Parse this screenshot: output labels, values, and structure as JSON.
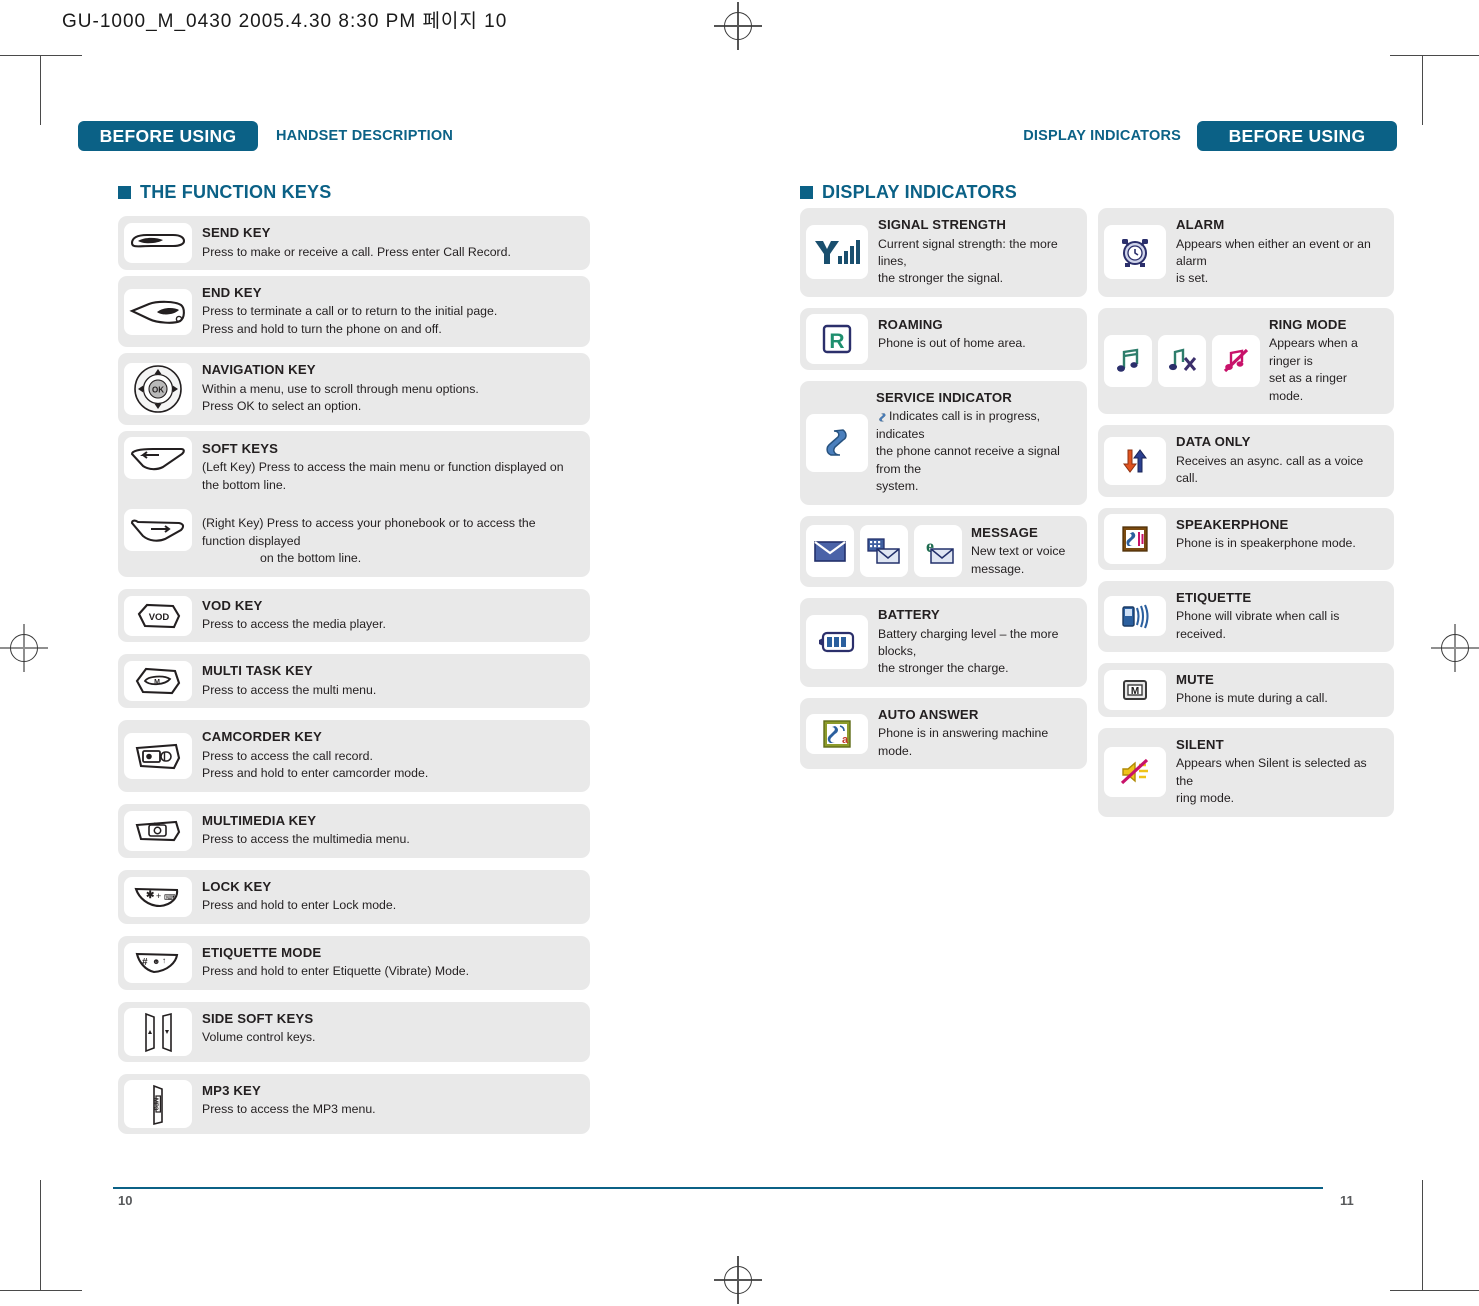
{
  "print_header": "GU-1000_M_0430  2005.4.30 8:30 PM  페이지 10",
  "brand_color": "#0b6186",
  "panel_color": "#e9e9e9",
  "left_page": {
    "running_head": {
      "tag": "BEFORE USING",
      "subject": "HANDSET DESCRIPTION"
    },
    "section_title": "THE FUNCTION KEYS",
    "page_number": "10",
    "items": [
      {
        "icon": "send-key-icon",
        "title": "SEND KEY",
        "lines": [
          "Press to make or receive a call. Press enter Call Record."
        ]
      },
      {
        "icon": "end-key-icon",
        "title": "END KEY",
        "lines": [
          "Press to terminate a call or to return to the initial page.",
          "Press and hold to turn the phone on and off."
        ]
      },
      {
        "icon": "navigation-key-icon",
        "title": "NAVIGATION KEY",
        "lines": [
          "Within a menu, use to scroll through menu options.",
          "Press  OK  to select an option."
        ]
      },
      {
        "icon": "soft-key-left-icon",
        "title": "SOFT KEYS",
        "lines": [
          "(Left Key) Press to access the main menu or function displayed on the bottom line."
        ],
        "second_icon": "soft-key-right-icon",
        "second_lines": [
          "(Right Key) Press to access your phonebook or to access the function displayed",
          "on the bottom line."
        ]
      },
      {
        "icon": "vod-key-icon",
        "title": "VOD KEY",
        "lines": [
          "Press to access the media player."
        ]
      },
      {
        "icon": "multi-task-key-icon",
        "title": "MULTI TASK KEY",
        "lines": [
          "Press to access the multi menu."
        ]
      },
      {
        "icon": "camcorder-key-icon",
        "title": "CAMCORDER KEY",
        "lines": [
          "Press to access the call record.",
          "Press and hold to enter camcorder mode."
        ]
      },
      {
        "icon": "multimedia-key-icon",
        "title": "MULTIMEDIA KEY",
        "lines": [
          "Press to access the multimedia menu."
        ]
      },
      {
        "icon": "lock-key-icon",
        "title": "LOCK KEY",
        "lines": [
          "Press and hold to enter Lock mode."
        ]
      },
      {
        "icon": "etiquette-mode-key-icon",
        "title": "ETIQUETTE MODE",
        "lines": [
          "Press and hold to enter Etiquette (Vibrate) Mode."
        ]
      },
      {
        "icon": "side-soft-keys-icon",
        "title": "SIDE SOFT KEYS",
        "lines": [
          "Volume control keys."
        ]
      },
      {
        "icon": "mp3-key-icon",
        "title": "MP3 KEY",
        "lines": [
          "Press to access the MP3 menu."
        ]
      }
    ]
  },
  "right_page": {
    "running_head": {
      "tag": "BEFORE USING",
      "subject": "DISPLAY INDICATORS"
    },
    "section_title": "DISPLAY INDICATORS",
    "page_number": "11",
    "column_left": [
      {
        "icon": "signal-strength-icon",
        "title": "SIGNAL STRENGTH",
        "lines": [
          "Current signal strength: the more lines,",
          "the stronger the signal."
        ]
      },
      {
        "icon": "roaming-icon",
        "title": "ROAMING",
        "lines": [
          "Phone is out of home area."
        ]
      },
      {
        "icon": "service-indicator-icon",
        "title": "SERVICE INDICATOR",
        "lines": [
          "Indicates call is in progress,  indicates",
          "the phone cannot receive a signal from the",
          "system."
        ]
      },
      {
        "icon": "message-icon",
        "icons": [
          "mail-envelope-icon",
          "text-message-icon",
          "voice-message-icon"
        ],
        "title": "MESSAGE",
        "lines": [
          "New text or voice",
          "message."
        ]
      },
      {
        "icon": "battery-icon",
        "title": "BATTERY",
        "lines": [
          "Battery charging level – the more blocks,",
          "the stronger the charge."
        ]
      },
      {
        "icon": "auto-answer-icon",
        "title": "AUTO ANSWER",
        "lines": [
          "Phone is in answering machine mode."
        ]
      }
    ],
    "column_right": [
      {
        "icon": "alarm-icon",
        "title": "ALARM",
        "lines": [
          "Appears when either an event or an alarm",
          "is set."
        ]
      },
      {
        "icon": "ring-mode-icon",
        "icons": [
          "ringer-on-icon",
          "ringer-off-icon",
          "ringer-silent-icon"
        ],
        "title": "RING MODE",
        "lines": [
          "Appears when a ringer is",
          "set as a ringer mode."
        ]
      },
      {
        "icon": "data-only-icon",
        "title": "DATA ONLY",
        "lines": [
          "Receives an async. call as a voice call."
        ]
      },
      {
        "icon": "speakerphone-icon",
        "title": "SPEAKERPHONE",
        "lines": [
          "Phone is in speakerphone mode."
        ]
      },
      {
        "icon": "etiquette-icon",
        "title": "ETIQUETTE",
        "lines": [
          "Phone will vibrate when call is received."
        ]
      },
      {
        "icon": "mute-icon",
        "title": "MUTE",
        "lines": [
          "Phone is mute during a call."
        ]
      },
      {
        "icon": "silent-icon",
        "title": "SILENT",
        "lines": [
          "Appears when Silent is selected as the",
          "ring mode."
        ]
      }
    ]
  }
}
